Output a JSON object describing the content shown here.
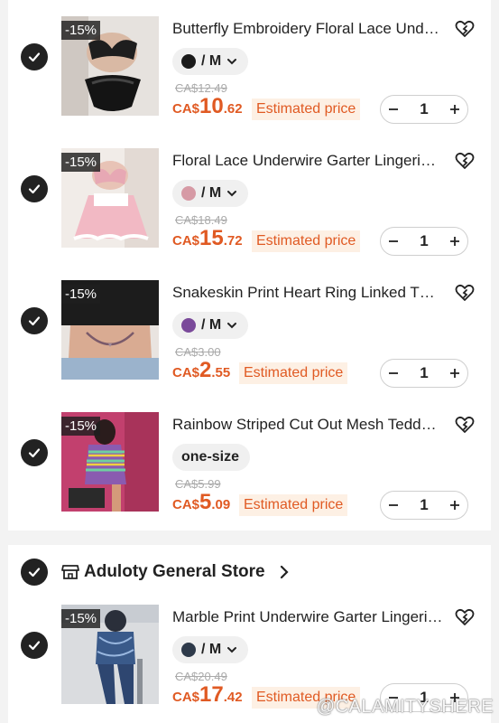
{
  "cart": {
    "items": [
      {
        "discount": "-15%",
        "title": "Butterfly Embroidery Floral Lace Underwire Lingerie Set",
        "variant": "/ M",
        "swatch_color": "#1a1a1a",
        "original_price": "CA$12.49",
        "price_currency": "CA$",
        "price_int": "10",
        "price_dec": ".62",
        "estimated_label": "Estimated price",
        "quantity": "1"
      },
      {
        "discount": "-15%",
        "title": "Floral Lace Underwire Garter Lingerie Set",
        "variant": "/ M",
        "swatch_color": "#d69aa5",
        "original_price": "CA$18.49",
        "price_currency": "CA$",
        "price_int": "15",
        "price_dec": ".72",
        "estimated_label": "Estimated price",
        "quantity": "1"
      },
      {
        "discount": "-15%",
        "title": "Snakeskin Print Heart Ring Linked Thong",
        "variant": "/ M",
        "swatch_color": "#7a4a9a",
        "original_price": "CA$3.00",
        "price_currency": "CA$",
        "price_int": "2",
        "price_dec": ".55",
        "estimated_label": "Estimated price",
        "quantity": "1"
      },
      {
        "discount": "-15%",
        "title": "Rainbow Striped Cut Out Mesh Teddy Bodysuit",
        "variant": "one-size",
        "swatch_color": "",
        "original_price": "CA$5.99",
        "price_currency": "CA$",
        "price_int": "5",
        "price_dec": ".09",
        "estimated_label": "Estimated price",
        "quantity": "1"
      }
    ],
    "store": {
      "name": "Aduloty General Store",
      "items": [
        {
          "discount": "-15%",
          "title": "Marble Print Underwire Garter Lingerie Set",
          "variant": "/ M",
          "swatch_color": "#2e3a4a",
          "original_price": "CA$20.49",
          "price_currency": "CA$",
          "price_int": "17",
          "price_dec": ".42",
          "estimated_label": "Estimated price",
          "quantity": "1"
        }
      ]
    }
  },
  "icons": {
    "checkbox": "check-circle-icon",
    "wishlist": "heart-plus-icon",
    "store": "store-icon",
    "chevron": "chevron-right-icon",
    "dropdown": "chevron-down-icon",
    "minus": "minus-icon",
    "plus": "plus-icon"
  },
  "colors": {
    "price": "#e05a23",
    "estimated_bg": "#fdf0e4",
    "checkbox": "#222222"
  },
  "watermark": "@CALAMITYSHERE"
}
